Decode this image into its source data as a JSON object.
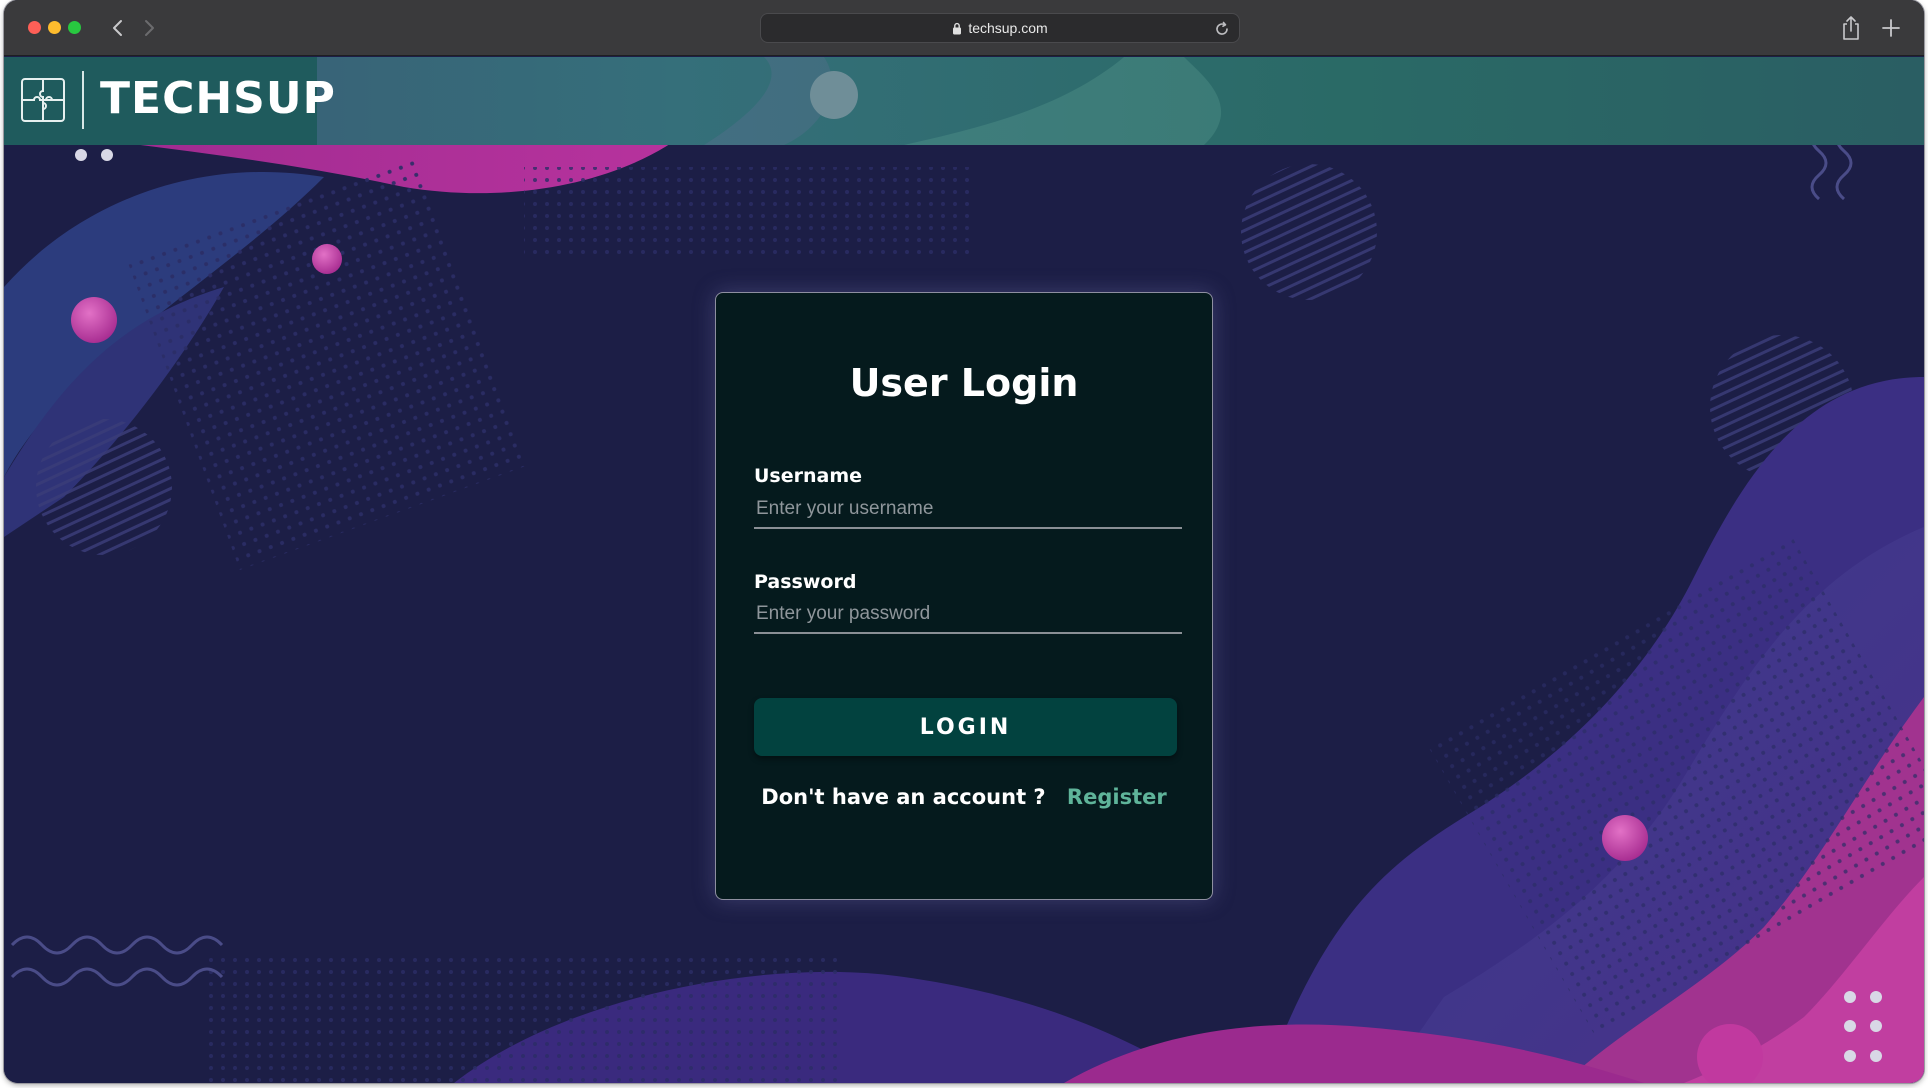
{
  "browser": {
    "url": "techsup.com"
  },
  "header": {
    "brand": "TECHSUP"
  },
  "login": {
    "title": "User Login",
    "username_label": "Username",
    "username_placeholder": "Enter your username",
    "password_label": "Password",
    "password_placeholder": "Enter your password",
    "button_label": "LOGIN",
    "no_account_text": "Don't have an account ?",
    "register_link": "Register"
  },
  "colors": {
    "page_background": "#1c1e46",
    "header_teal": "#2a6a66",
    "card_background": "#051a1d",
    "button": "#02423f",
    "link": "#5fb49a",
    "accent_magenta": "#b8339e"
  }
}
